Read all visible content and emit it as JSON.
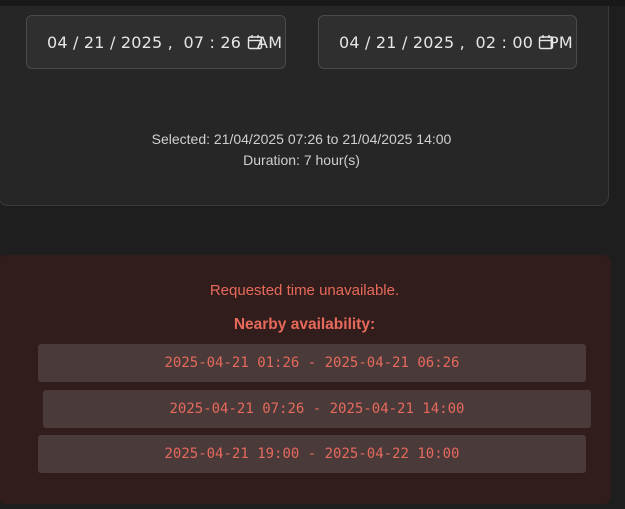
{
  "range": {
    "start": {
      "value": "04 / 21 / 2025 ,  07 : 26   AM"
    },
    "end": {
      "value": "04 / 21 / 2025 ,  02 : 00   PM"
    },
    "selected_text": "Selected: 21/04/2025 07:26 to 21/04/2025 14:00",
    "duration_text": "Duration: 7 hour(s)"
  },
  "availability": {
    "message": "Requested time unavailable.",
    "title": "Nearby availability:",
    "slots": [
      {
        "label": "2025-04-21 01:26 - 2025-04-21 06:26"
      },
      {
        "label": "2025-04-21 07:26 - 2025-04-21 14:00"
      },
      {
        "label": "2025-04-21 19:00 - 2025-04-22 10:00"
      }
    ]
  },
  "icons": {
    "calendar": "calendar-icon"
  },
  "colors": {
    "background": "#1e1e1e",
    "card": "#262626",
    "alert_bg": "#311d1c",
    "alert_text": "#e86a5b",
    "slot_bg": "#4a3a3a"
  }
}
